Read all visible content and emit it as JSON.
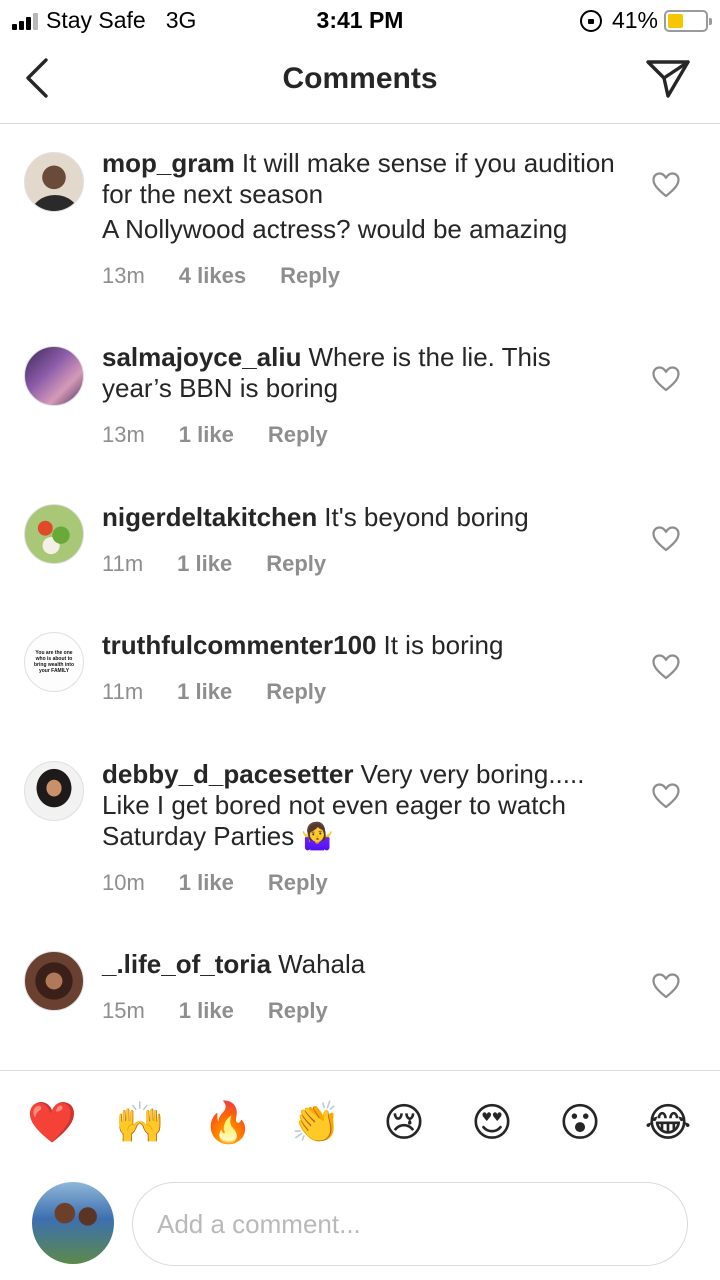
{
  "status_bar": {
    "carrier": "Stay Safe",
    "network": "3G",
    "time": "3:41 PM",
    "battery": "41%",
    "battery_level": 0.41
  },
  "header": {
    "title": "Comments"
  },
  "comments": [
    {
      "username": "mop_gram",
      "text": "It will make sense if you audition for the next season",
      "text2": "A Nollywood actress? would be amazing",
      "time": "13m",
      "likes": "4 likes",
      "reply": "Reply"
    },
    {
      "username": "salmajoyce_aliu",
      "text": "Where is the lie. This year’s BBN is boring",
      "time": "13m",
      "likes": "1 like",
      "reply": "Reply"
    },
    {
      "username": "nigerdeltakitchen",
      "text": "It's beyond boring",
      "time": "11m",
      "likes": "1 like",
      "reply": "Reply"
    },
    {
      "username": "truthfulcommenter100",
      "text": "It is boring",
      "time": "11m",
      "likes": "1 like",
      "reply": "Reply",
      "avatar_text": "You are the one who is about to bring wealth into your FAMILY"
    },
    {
      "username": "debby_d_pacesetter",
      "text": "Very very boring..... Like I get bored not even eager to watch Saturday Parties 🤷‍♀️",
      "time": "10m",
      "likes": "1 like",
      "reply": "Reply"
    },
    {
      "username": "_.life_of_toria",
      "text": "Wahala",
      "time": "15m",
      "likes": "1 like",
      "reply": "Reply"
    }
  ],
  "emoji_bar": [
    "❤️",
    "🙌",
    "🔥",
    "👏",
    "😢",
    "😍",
    "😮",
    "😂"
  ],
  "composer": {
    "placeholder": "Add a comment..."
  }
}
